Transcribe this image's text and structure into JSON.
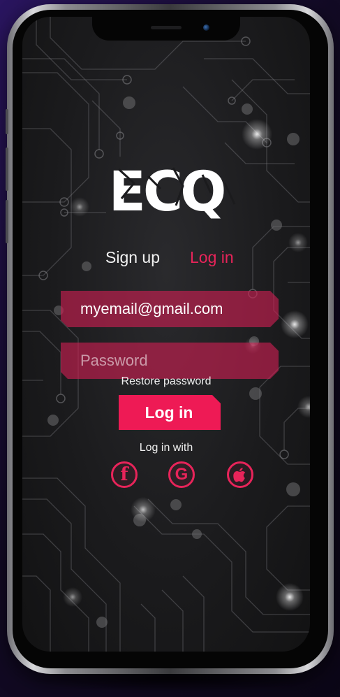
{
  "brand": {
    "logo_text": "ECQ",
    "accent_color": "#e8245a"
  },
  "auth_tabs": {
    "signup_label": "Sign up",
    "login_label": "Log in",
    "active": "Log in"
  },
  "form": {
    "email_value": "myemail@gmail.com",
    "password_placeholder": "Password",
    "restore_password_label": "Restore password",
    "submit_label": "Log in"
  },
  "social_login": {
    "heading": "Log in with",
    "providers": [
      {
        "name": "facebook",
        "icon": "facebook-icon",
        "glyph": "f"
      },
      {
        "name": "google",
        "icon": "google-icon",
        "glyph": "G"
      },
      {
        "name": "apple",
        "icon": "apple-icon"
      }
    ]
  },
  "theme": {
    "background": "#1b1b1d",
    "field_fill": "#ce1e52",
    "button_fill": "#ee1a55"
  }
}
